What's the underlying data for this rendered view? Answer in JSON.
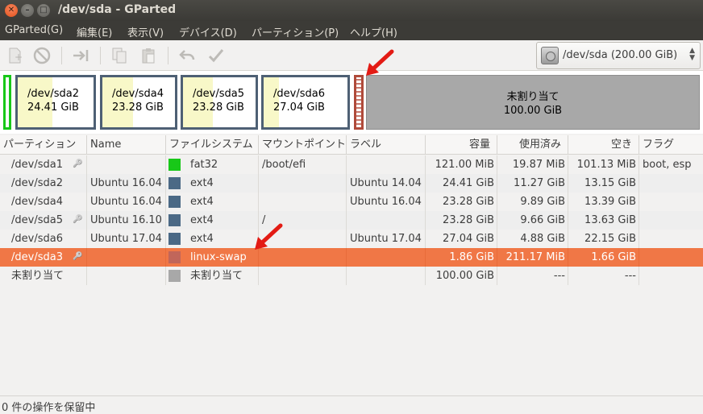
{
  "window": {
    "title": "/dev/sda - GParted"
  },
  "menu": [
    "GParted(G)",
    "編集(E)",
    "表示(V)",
    "デバイス(D)",
    "パーティション(P)",
    "ヘルプ(H)"
  ],
  "toolbar": {
    "icons": [
      "new-partition-icon",
      "delete-icon",
      "resize-move-icon",
      "copy-icon",
      "paste-icon",
      "undo-icon",
      "apply-icon"
    ]
  },
  "device": {
    "label": "/dev/sda   (200.00 GiB)"
  },
  "partition_map": [
    {
      "name": "/dev/sda2",
      "size": "24.41 GiB",
      "used_fraction": 0.46
    },
    {
      "name": "/dev/sda4",
      "size": "23.28 GiB",
      "used_fraction": 0.42
    },
    {
      "name": "/dev/sda5",
      "size": "23.28 GiB",
      "used_fraction": 0.41
    },
    {
      "name": "/dev/sda6",
      "size": "27.04 GiB",
      "used_fraction": 0.18
    }
  ],
  "unallocated_block": {
    "label": "未割り当て",
    "size": "100.00 GiB"
  },
  "table": {
    "headers": [
      "パーティション",
      "Name",
      "ファイルシステム",
      "マウントポイント",
      "ラベル",
      "容量",
      "使用済み",
      "空き",
      "フラグ"
    ],
    "rows": [
      {
        "partition": "/dev/sda1",
        "key": true,
        "name": "",
        "fs": "fat32",
        "color": "#18c818",
        "mount": "/boot/efi",
        "label": "",
        "size": "121.00 MiB",
        "used": "19.87 MiB",
        "free": "101.13 MiB",
        "flags": "boot, esp"
      },
      {
        "partition": "/dev/sda2",
        "key": false,
        "name": "Ubuntu 16.04",
        "fs": "ext4",
        "color": "#4b6985",
        "mount": "",
        "label": "Ubuntu 14.04",
        "size": "24.41 GiB",
        "used": "11.27 GiB",
        "free": "13.15 GiB",
        "flags": ""
      },
      {
        "partition": "/dev/sda4",
        "key": false,
        "name": "Ubuntu 16.04",
        "fs": "ext4",
        "color": "#4b6985",
        "mount": "",
        "label": "Ubuntu 16.04",
        "size": "23.28 GiB",
        "used": "9.89 GiB",
        "free": "13.39 GiB",
        "flags": ""
      },
      {
        "partition": "/dev/sda5",
        "key": true,
        "name": "Ubuntu 16.10",
        "fs": "ext4",
        "color": "#4b6985",
        "mount": "/",
        "label": "",
        "size": "23.28 GiB",
        "used": "9.66 GiB",
        "free": "13.63 GiB",
        "flags": ""
      },
      {
        "partition": "/dev/sda6",
        "key": false,
        "name": "Ubuntu 17.04",
        "fs": "ext4",
        "color": "#4b6985",
        "mount": "",
        "label": "Ubuntu 17.04",
        "size": "27.04 GiB",
        "used": "4.88 GiB",
        "free": "22.15 GiB",
        "flags": ""
      },
      {
        "partition": "/dev/sda3",
        "key": true,
        "name": "",
        "fs": "linux-swap",
        "color": "#c1665a",
        "mount": "",
        "label": "",
        "size": "1.86 GiB",
        "used": "211.17 MiB",
        "free": "1.66 GiB",
        "flags": ""
      },
      {
        "partition": "未割り当て",
        "key": false,
        "name": "",
        "fs": "未割り当て",
        "color": "#a8a8a8",
        "mount": "",
        "label": "",
        "size": "100.00 GiB",
        "used": "---",
        "free": "---",
        "flags": ""
      }
    ],
    "selected_index": 5
  },
  "status": "0 件の操作を保留中"
}
